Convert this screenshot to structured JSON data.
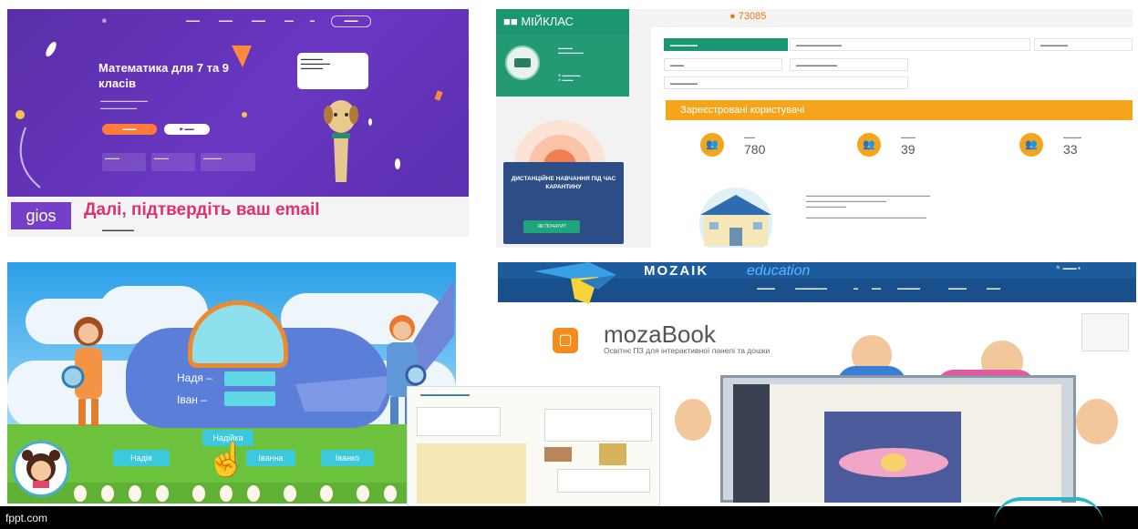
{
  "slide": {
    "footer_text": "fppt.com"
  },
  "gios_panel": {
    "hero_title": "Математика для 7 та 9 класів",
    "logo_text": "gios",
    "confirm_text": "Далі, підтвердіть ваш email",
    "colors": {
      "hero": "#6a37c2",
      "accent": "#e0306f",
      "cta": "#ff7a3d"
    }
  },
  "myklas_panel": {
    "brand": "МІЙКЛАС",
    "score": "73085",
    "promo_text": "ДИСТАНЦІЙНЕ НАВЧАННЯ ПІД ЧАС КАРАНТИНУ",
    "promo_button": "ЯК ПОЧАТИ?",
    "section_title": "Зареєстровані користувачі",
    "stats": [
      {
        "icon": "students-icon",
        "value": "780"
      },
      {
        "icon": "teachers-icon",
        "value": "39"
      },
      {
        "icon": "class-teacher-icon",
        "value": "33"
      }
    ],
    "colors": {
      "green": "#1b9672",
      "orange": "#f5a51b"
    }
  },
  "game_panel": {
    "names": [
      "Надя –",
      "Іван –"
    ],
    "choices": [
      "Надія",
      "Іванна",
      "Іванко",
      "Надійка"
    ],
    "colors": {
      "sky": "#2a9fe8",
      "grass": "#6cc23c",
      "chip": "#3cc9dc"
    }
  },
  "mozaik_panel": {
    "brand": "MOZAIK",
    "brand_suffix": "education",
    "product": "mozaBook",
    "product_desc": "Освітнє ПЗ для інтерактивної панелі та дошки",
    "colors": {
      "header": "#194f8a",
      "product_icon": "#f28c1e"
    }
  }
}
